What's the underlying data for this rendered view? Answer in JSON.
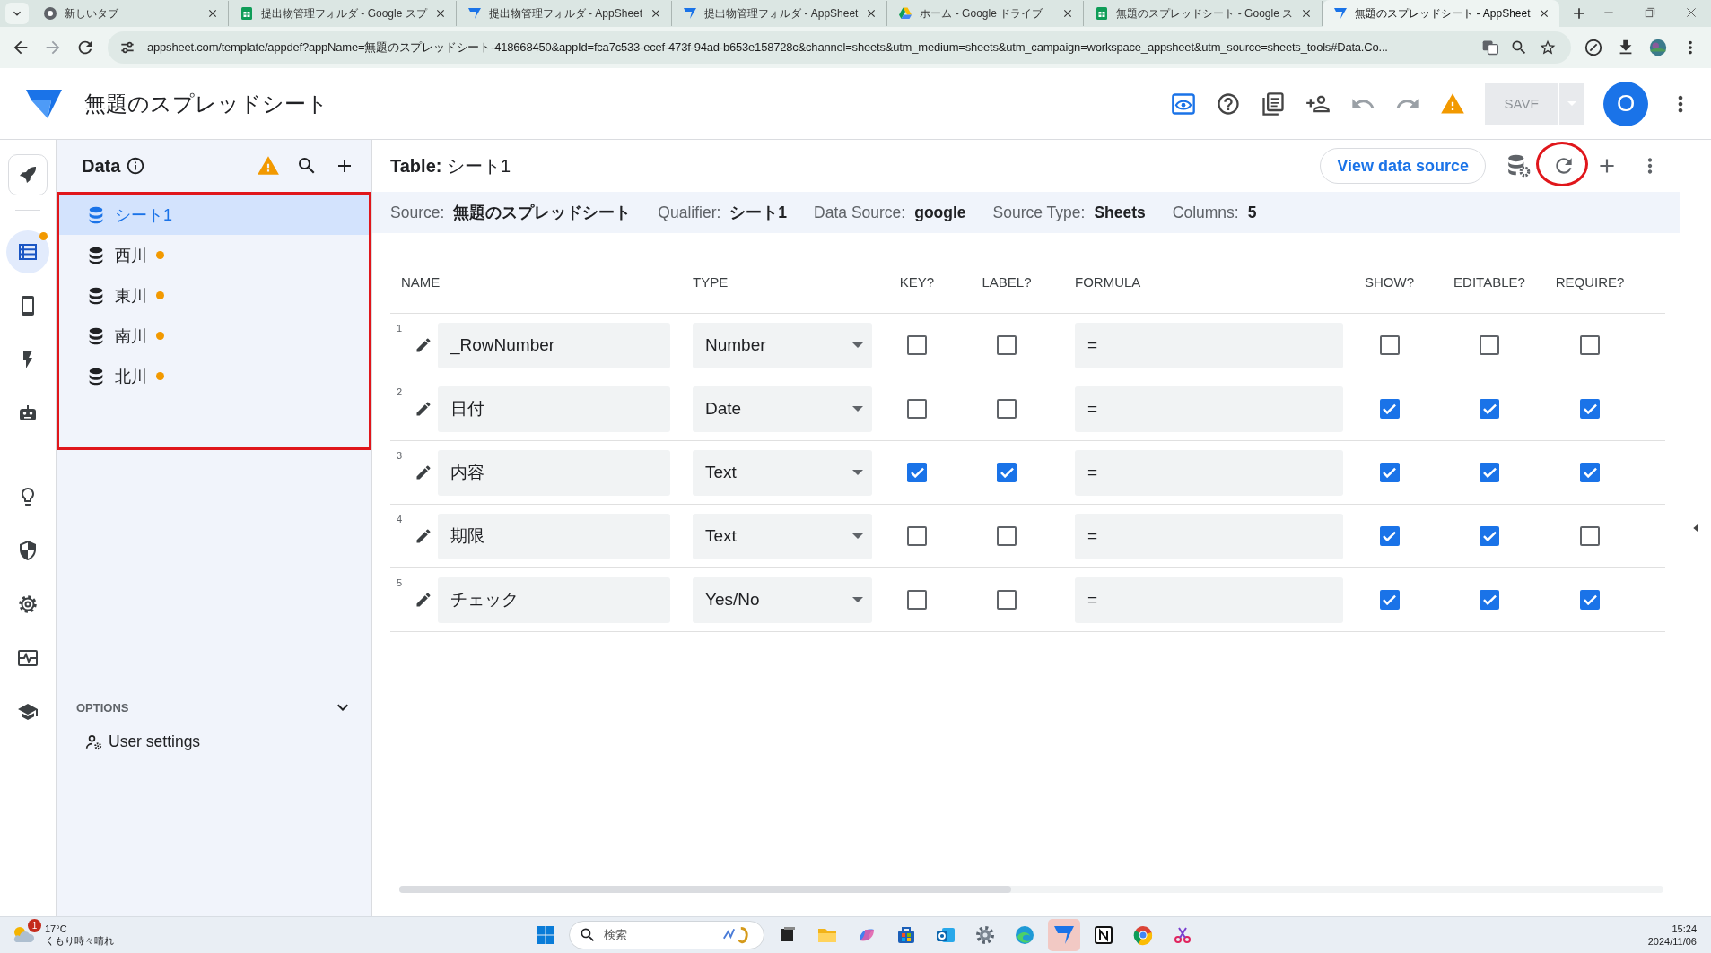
{
  "browser": {
    "tabs": [
      {
        "kind": "chrome",
        "title": "新しいタブ",
        "selected": false
      },
      {
        "kind": "sheets",
        "title": "提出物管理フォルダ - Google スプ",
        "selected": false
      },
      {
        "kind": "appsheet",
        "title": "提出物管理フォルダ - AppSheet",
        "selected": false
      },
      {
        "kind": "appsheet",
        "title": "提出物管理フォルダ - AppSheet",
        "selected": false
      },
      {
        "kind": "drive",
        "title": "ホーム - Google ドライブ",
        "selected": false
      },
      {
        "kind": "sheets",
        "title": "無題のスプレッドシート - Google ス",
        "selected": false
      },
      {
        "kind": "appsheet",
        "title": "無題のスプレッドシート - AppSheet",
        "selected": true
      }
    ],
    "url": "appsheet.com/template/appdef?appName=無題のスプレッドシート-418668450&appId=fca7c533-ecef-473f-94ad-b653e158728c&channel=sheets&utm_medium=sheets&utm_campaign=workspace_appsheet&utm_source=sheets_tools#Data.Co..."
  },
  "app": {
    "title": "無題のスプレッドシート",
    "save": {
      "label": "SAVE",
      "disabled": true
    },
    "avatar": "O"
  },
  "rail_groups": [
    [
      {
        "kind": "rocket",
        "selected": false,
        "badge": false
      }
    ],
    [
      {
        "kind": "data",
        "selected": true,
        "badge": true
      },
      {
        "kind": "ux",
        "selected": false,
        "badge": false
      },
      {
        "kind": "actions",
        "selected": false,
        "badge": false
      },
      {
        "kind": "bots",
        "selected": false,
        "badge": false
      }
    ],
    [
      {
        "kind": "intelligence",
        "selected": false,
        "badge": false
      },
      {
        "kind": "security",
        "selected": false,
        "badge": false
      },
      {
        "kind": "settings",
        "selected": false,
        "badge": false
      },
      {
        "kind": "monitor",
        "selected": false,
        "badge": false
      },
      {
        "kind": "learn",
        "selected": false,
        "badge": false
      }
    ]
  ],
  "sidebar": {
    "title": "Data",
    "tables": [
      {
        "name": "シート1",
        "selected": true,
        "dot": false
      },
      {
        "name": "西川",
        "selected": false,
        "dot": true
      },
      {
        "name": "東川",
        "selected": false,
        "dot": true
      },
      {
        "name": "南川",
        "selected": false,
        "dot": true
      },
      {
        "name": "北川",
        "selected": false,
        "dot": true
      }
    ],
    "options_label": "OPTIONS",
    "user_settings": "User settings"
  },
  "table": {
    "title": "**Table:** シート1",
    "view_button": "View data source",
    "info": [
      {
        "label": "Source:",
        "value": "無題のスプレッドシート"
      },
      {
        "label": "Qualifier:",
        "value": "シート1"
      },
      {
        "label": "Data Source:",
        "value": "google"
      },
      {
        "label": "Source Type:",
        "value": "Sheets"
      },
      {
        "label": "Columns:",
        "value": "5"
      }
    ],
    "columns": [
      "NAME",
      "TYPE",
      "KEY?",
      "LABEL?",
      "FORMULA",
      "SHOW?",
      "EDITABLE?",
      "REQUIRE?"
    ],
    "rows": [
      {
        "number": "1",
        "name": "_RowNumber",
        "type": "Number",
        "key": false,
        "label": false,
        "formula": "=",
        "show": false,
        "editable": false,
        "require": false
      },
      {
        "number": "2",
        "name": "日付",
        "type": "Date",
        "key": false,
        "label": false,
        "formula": "=",
        "show": true,
        "editable": true,
        "require": true
      },
      {
        "number": "3",
        "name": "内容",
        "type": "Text",
        "key": true,
        "label": true,
        "formula": "=",
        "show": true,
        "editable": true,
        "require": true
      },
      {
        "number": "4",
        "name": "期限",
        "type": "Text",
        "key": false,
        "label": false,
        "formula": "=",
        "show": true,
        "editable": true,
        "require": false
      },
      {
        "number": "5",
        "name": "チェック",
        "type": "Yes/No",
        "key": false,
        "label": false,
        "formula": "=",
        "show": true,
        "editable": true,
        "require": true
      }
    ]
  },
  "taskbar": {
    "weather": {
      "temp": "17°C",
      "desc": "くもり時々晴れ",
      "badge": "1"
    },
    "search_placeholder": "検索",
    "apps": [
      {
        "kind": "start",
        "selected": false
      },
      {
        "kind": "taskview",
        "selected": false
      },
      {
        "kind": "folder",
        "selected": false
      },
      {
        "kind": "copilot",
        "selected": false
      },
      {
        "kind": "store",
        "selected": false
      },
      {
        "kind": "mail",
        "selected": false
      },
      {
        "kind": "settings",
        "selected": false
      },
      {
        "kind": "edge",
        "selected": false
      },
      {
        "kind": "appsheet",
        "selected": true
      },
      {
        "kind": "notion",
        "selected": false
      },
      {
        "kind": "chrome",
        "selected": false
      },
      {
        "kind": "snip",
        "selected": false
      }
    ],
    "time": "15:24",
    "date": "2024/11/06"
  }
}
